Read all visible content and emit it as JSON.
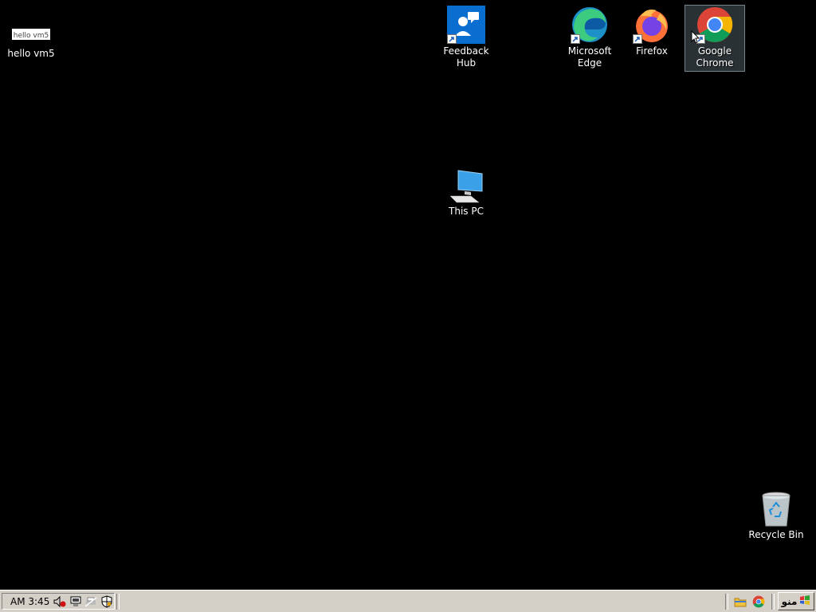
{
  "desktop": {
    "icons": {
      "hello_vm5": {
        "label": "hello vm5",
        "badge_text": "hello vm5"
      },
      "feedback_hub": {
        "label": "Feedback Hub"
      },
      "microsoft_edge": {
        "label": "Microsoft Edge"
      },
      "firefox": {
        "label": "Firefox"
      },
      "google_chrome": {
        "label": "Google Chrome",
        "selected": true
      },
      "this_pc": {
        "label": "This PC"
      },
      "recycle_bin": {
        "label": "Recycle Bin"
      }
    }
  },
  "taskbar": {
    "clock": "AM 3:45",
    "start_label": "منو",
    "tray_icons": [
      "speaker-muted-icon",
      "network-icon",
      "printer-icon",
      "security-shield-icon"
    ],
    "quick_launch": [
      "file-explorer-icon",
      "google-chrome-icon"
    ]
  },
  "colors": {
    "desktop_bg": "#000000",
    "taskbar_bg": "#d4d0c8",
    "feedback_blue": "#0a6ed1",
    "chrome_red": "#db4437",
    "chrome_yellow": "#f4b400",
    "chrome_green": "#0f9d58",
    "chrome_blue": "#4285f4"
  }
}
